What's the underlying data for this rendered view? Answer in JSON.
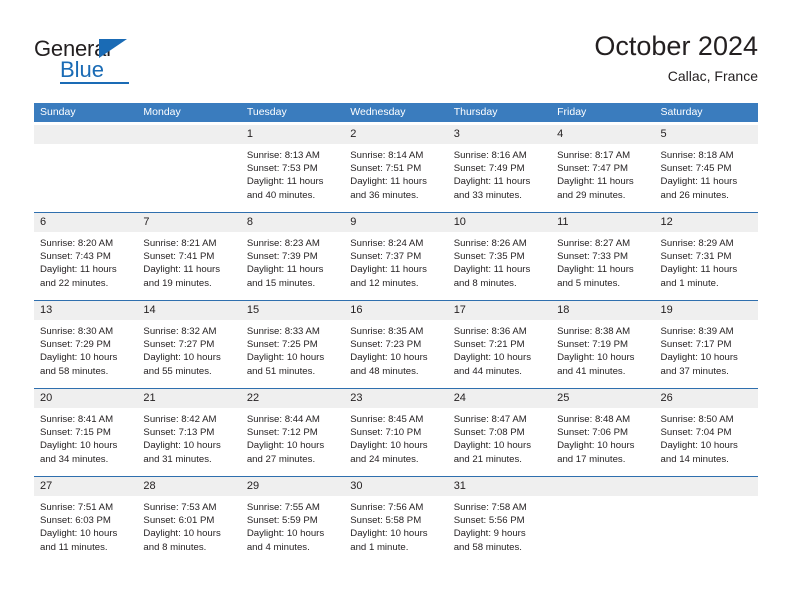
{
  "brand": {
    "name_part1": "General",
    "name_part2": "Blue",
    "accent_color": "#1a6bb5"
  },
  "header": {
    "title": "October 2024",
    "subtitle": "Callac, France"
  },
  "calendar": {
    "header_color": "#3a7cbe",
    "day_names": [
      "Sunday",
      "Monday",
      "Tuesday",
      "Wednesday",
      "Thursday",
      "Friday",
      "Saturday"
    ],
    "weeks": [
      [
        {
          "day": "",
          "lines": []
        },
        {
          "day": "",
          "lines": []
        },
        {
          "day": "1",
          "lines": [
            "Sunrise: 8:13 AM",
            "Sunset: 7:53 PM",
            "Daylight: 11 hours",
            "and 40 minutes."
          ]
        },
        {
          "day": "2",
          "lines": [
            "Sunrise: 8:14 AM",
            "Sunset: 7:51 PM",
            "Daylight: 11 hours",
            "and 36 minutes."
          ]
        },
        {
          "day": "3",
          "lines": [
            "Sunrise: 8:16 AM",
            "Sunset: 7:49 PM",
            "Daylight: 11 hours",
            "and 33 minutes."
          ]
        },
        {
          "day": "4",
          "lines": [
            "Sunrise: 8:17 AM",
            "Sunset: 7:47 PM",
            "Daylight: 11 hours",
            "and 29 minutes."
          ]
        },
        {
          "day": "5",
          "lines": [
            "Sunrise: 8:18 AM",
            "Sunset: 7:45 PM",
            "Daylight: 11 hours",
            "and 26 minutes."
          ]
        }
      ],
      [
        {
          "day": "6",
          "lines": [
            "Sunrise: 8:20 AM",
            "Sunset: 7:43 PM",
            "Daylight: 11 hours",
            "and 22 minutes."
          ]
        },
        {
          "day": "7",
          "lines": [
            "Sunrise: 8:21 AM",
            "Sunset: 7:41 PM",
            "Daylight: 11 hours",
            "and 19 minutes."
          ]
        },
        {
          "day": "8",
          "lines": [
            "Sunrise: 8:23 AM",
            "Sunset: 7:39 PM",
            "Daylight: 11 hours",
            "and 15 minutes."
          ]
        },
        {
          "day": "9",
          "lines": [
            "Sunrise: 8:24 AM",
            "Sunset: 7:37 PM",
            "Daylight: 11 hours",
            "and 12 minutes."
          ]
        },
        {
          "day": "10",
          "lines": [
            "Sunrise: 8:26 AM",
            "Sunset: 7:35 PM",
            "Daylight: 11 hours",
            "and 8 minutes."
          ]
        },
        {
          "day": "11",
          "lines": [
            "Sunrise: 8:27 AM",
            "Sunset: 7:33 PM",
            "Daylight: 11 hours",
            "and 5 minutes."
          ]
        },
        {
          "day": "12",
          "lines": [
            "Sunrise: 8:29 AM",
            "Sunset: 7:31 PM",
            "Daylight: 11 hours",
            "and 1 minute."
          ]
        }
      ],
      [
        {
          "day": "13",
          "lines": [
            "Sunrise: 8:30 AM",
            "Sunset: 7:29 PM",
            "Daylight: 10 hours",
            "and 58 minutes."
          ]
        },
        {
          "day": "14",
          "lines": [
            "Sunrise: 8:32 AM",
            "Sunset: 7:27 PM",
            "Daylight: 10 hours",
            "and 55 minutes."
          ]
        },
        {
          "day": "15",
          "lines": [
            "Sunrise: 8:33 AM",
            "Sunset: 7:25 PM",
            "Daylight: 10 hours",
            "and 51 minutes."
          ]
        },
        {
          "day": "16",
          "lines": [
            "Sunrise: 8:35 AM",
            "Sunset: 7:23 PM",
            "Daylight: 10 hours",
            "and 48 minutes."
          ]
        },
        {
          "day": "17",
          "lines": [
            "Sunrise: 8:36 AM",
            "Sunset: 7:21 PM",
            "Daylight: 10 hours",
            "and 44 minutes."
          ]
        },
        {
          "day": "18",
          "lines": [
            "Sunrise: 8:38 AM",
            "Sunset: 7:19 PM",
            "Daylight: 10 hours",
            "and 41 minutes."
          ]
        },
        {
          "day": "19",
          "lines": [
            "Sunrise: 8:39 AM",
            "Sunset: 7:17 PM",
            "Daylight: 10 hours",
            "and 37 minutes."
          ]
        }
      ],
      [
        {
          "day": "20",
          "lines": [
            "Sunrise: 8:41 AM",
            "Sunset: 7:15 PM",
            "Daylight: 10 hours",
            "and 34 minutes."
          ]
        },
        {
          "day": "21",
          "lines": [
            "Sunrise: 8:42 AM",
            "Sunset: 7:13 PM",
            "Daylight: 10 hours",
            "and 31 minutes."
          ]
        },
        {
          "day": "22",
          "lines": [
            "Sunrise: 8:44 AM",
            "Sunset: 7:12 PM",
            "Daylight: 10 hours",
            "and 27 minutes."
          ]
        },
        {
          "day": "23",
          "lines": [
            "Sunrise: 8:45 AM",
            "Sunset: 7:10 PM",
            "Daylight: 10 hours",
            "and 24 minutes."
          ]
        },
        {
          "day": "24",
          "lines": [
            "Sunrise: 8:47 AM",
            "Sunset: 7:08 PM",
            "Daylight: 10 hours",
            "and 21 minutes."
          ]
        },
        {
          "day": "25",
          "lines": [
            "Sunrise: 8:48 AM",
            "Sunset: 7:06 PM",
            "Daylight: 10 hours",
            "and 17 minutes."
          ]
        },
        {
          "day": "26",
          "lines": [
            "Sunrise: 8:50 AM",
            "Sunset: 7:04 PM",
            "Daylight: 10 hours",
            "and 14 minutes."
          ]
        }
      ],
      [
        {
          "day": "27",
          "lines": [
            "Sunrise: 7:51 AM",
            "Sunset: 6:03 PM",
            "Daylight: 10 hours",
            "and 11 minutes."
          ]
        },
        {
          "day": "28",
          "lines": [
            "Sunrise: 7:53 AM",
            "Sunset: 6:01 PM",
            "Daylight: 10 hours",
            "and 8 minutes."
          ]
        },
        {
          "day": "29",
          "lines": [
            "Sunrise: 7:55 AM",
            "Sunset: 5:59 PM",
            "Daylight: 10 hours",
            "and 4 minutes."
          ]
        },
        {
          "day": "30",
          "lines": [
            "Sunrise: 7:56 AM",
            "Sunset: 5:58 PM",
            "Daylight: 10 hours",
            "and 1 minute."
          ]
        },
        {
          "day": "31",
          "lines": [
            "Sunrise: 7:58 AM",
            "Sunset: 5:56 PM",
            "Daylight: 9 hours",
            "and 58 minutes."
          ]
        },
        {
          "day": "",
          "lines": []
        },
        {
          "day": "",
          "lines": []
        }
      ]
    ]
  }
}
